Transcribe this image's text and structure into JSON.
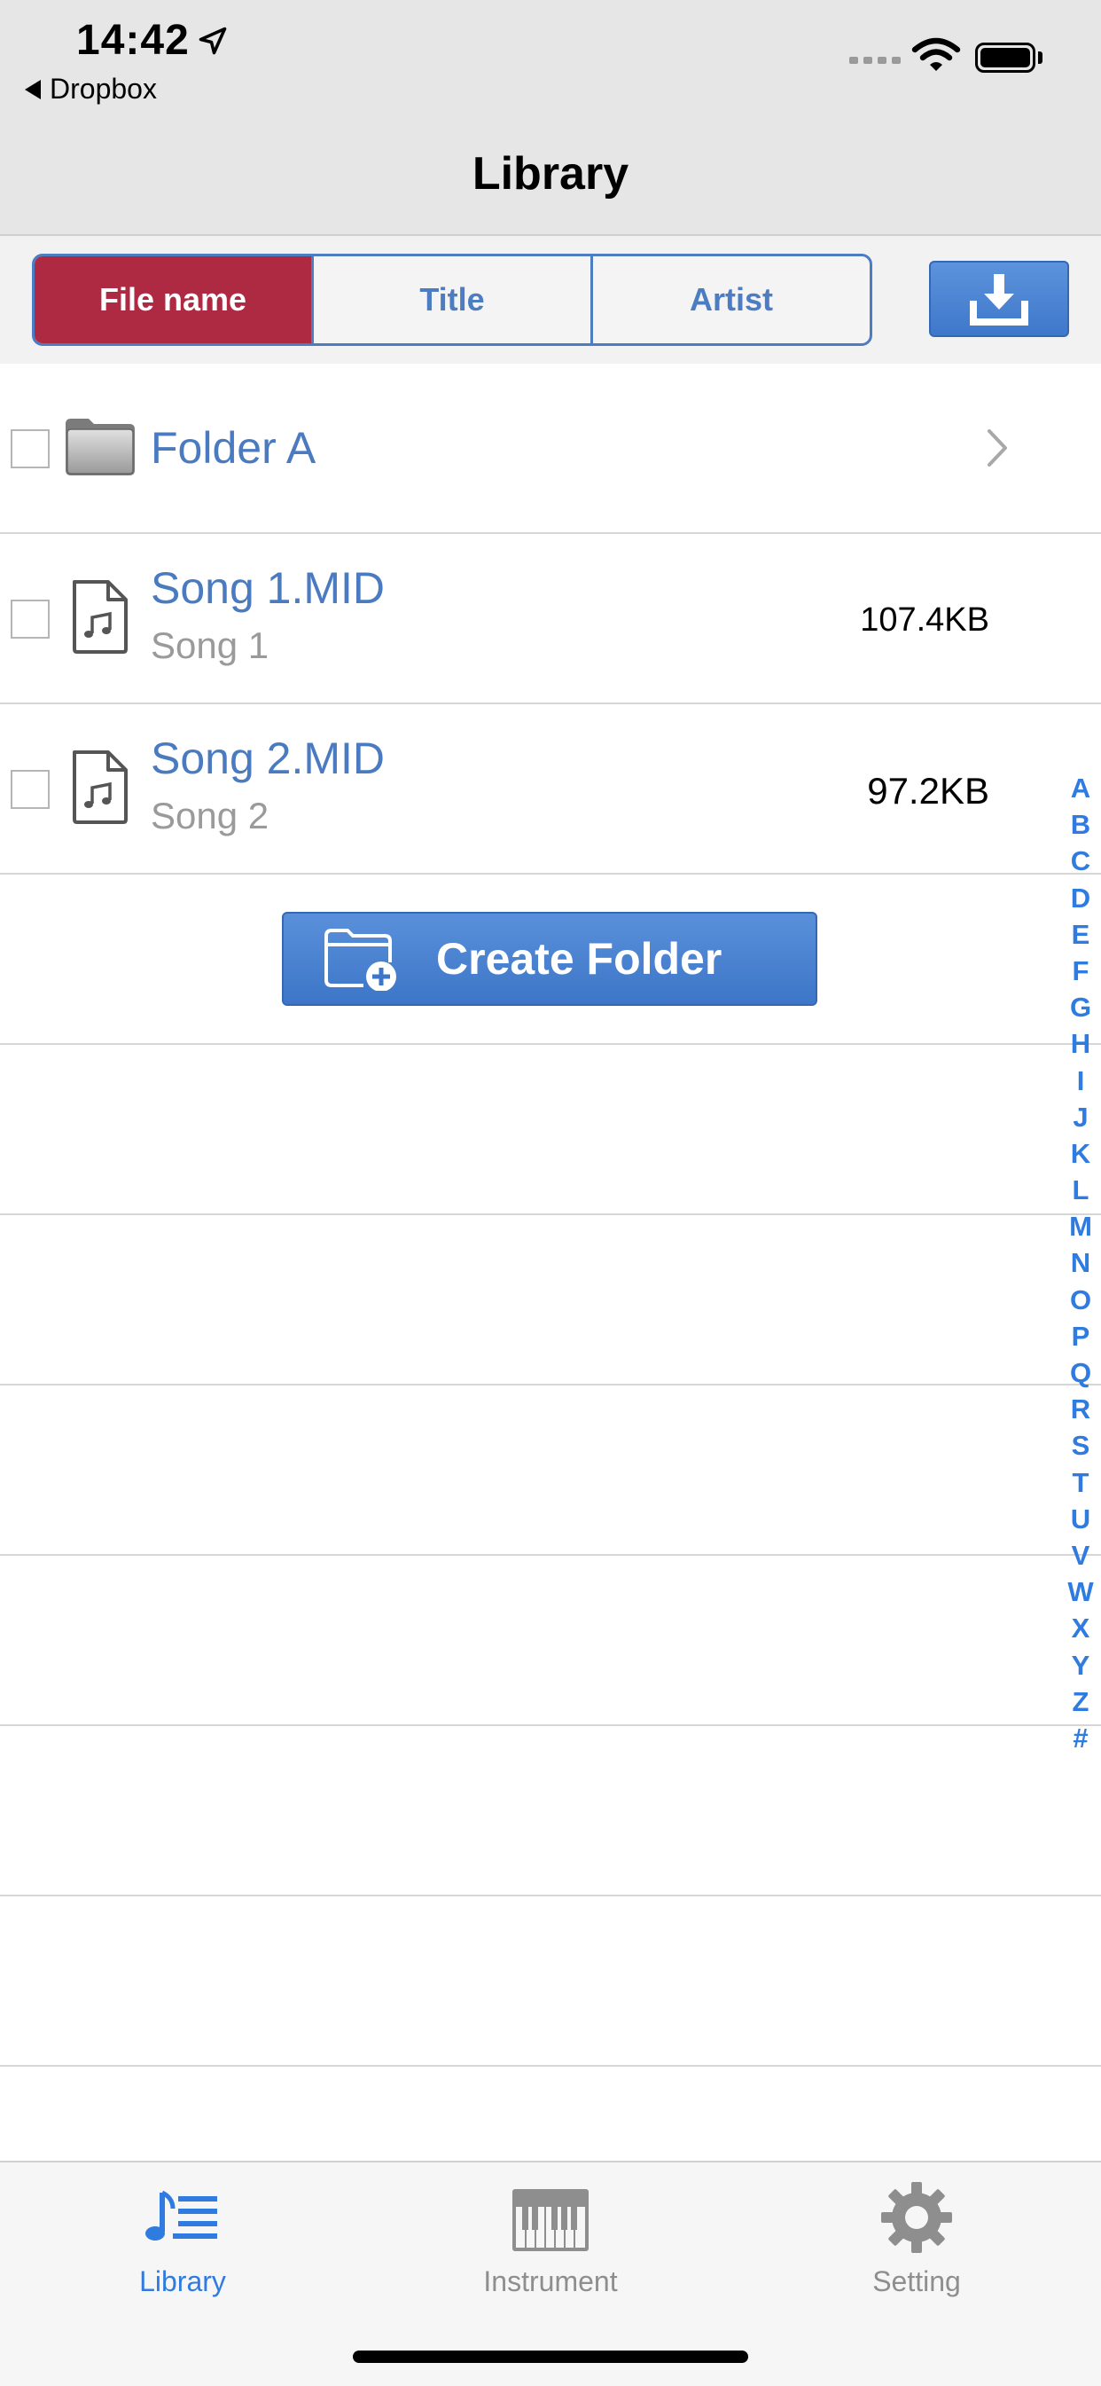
{
  "status": {
    "time": "14:42",
    "back_label": "Dropbox"
  },
  "nav": {
    "title": "Library"
  },
  "sort": {
    "segments": [
      "File name",
      "Title",
      "Artist"
    ],
    "selected": "File name"
  },
  "items": [
    {
      "type": "folder",
      "name": "Folder A"
    },
    {
      "type": "file",
      "name": "Song 1.MID",
      "title": "Song 1",
      "size": "107.4KB"
    },
    {
      "type": "file",
      "name": "Song 2.MID",
      "title": "Song 2",
      "size": "97.2KB"
    }
  ],
  "create_folder": {
    "label": "Create Folder"
  },
  "index": [
    "A",
    "B",
    "C",
    "D",
    "E",
    "F",
    "G",
    "H",
    "I",
    "J",
    "K",
    "L",
    "M",
    "N",
    "O",
    "P",
    "Q",
    "R",
    "S",
    "T",
    "U",
    "V",
    "W",
    "X",
    "Y",
    "Z",
    "#"
  ],
  "tabs": [
    {
      "label": "Library",
      "icon": "music-list-icon",
      "active": true
    },
    {
      "label": "Instrument",
      "icon": "piano-keys-icon",
      "active": false
    },
    {
      "label": "Setting",
      "icon": "gear-icon",
      "active": false
    }
  ],
  "colors": {
    "accent": "#2f7be0",
    "selected_segment": "#ae2942",
    "link_text": "#4a7ac0"
  }
}
